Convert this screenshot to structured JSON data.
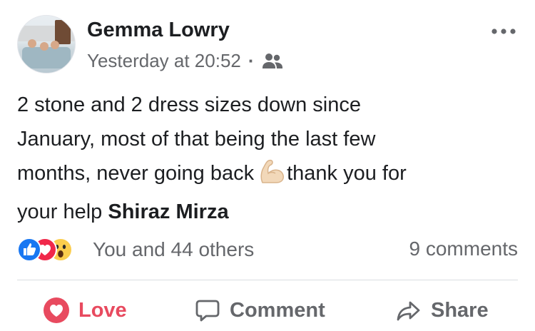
{
  "post": {
    "author": "Gemma Lowry",
    "timestamp": "Yesterday at 20:52",
    "separator": "·",
    "audience_icon": "friends-icon",
    "text_lines": [
      "2 stone and 2 dress sizes down since",
      "January, most of that being the last few",
      "months, never going back",
      "thank you for",
      "your help "
    ],
    "mention": "Shiraz Mirza",
    "emoji": "flexed-biceps"
  },
  "reactions": {
    "icons": [
      "like-reaction-icon",
      "love-reaction-icon",
      "wow-reaction-icon"
    ],
    "summary": "You and 44 others"
  },
  "comments": {
    "count_label": "9 comments"
  },
  "actions": {
    "love_label": "Love",
    "comment_label": "Comment",
    "share_label": "Share"
  },
  "colors": {
    "love_red": "#e84a5f",
    "like_blue": "#1877f2",
    "secondary_text": "#65676b",
    "primary_text": "#1c1e21"
  }
}
